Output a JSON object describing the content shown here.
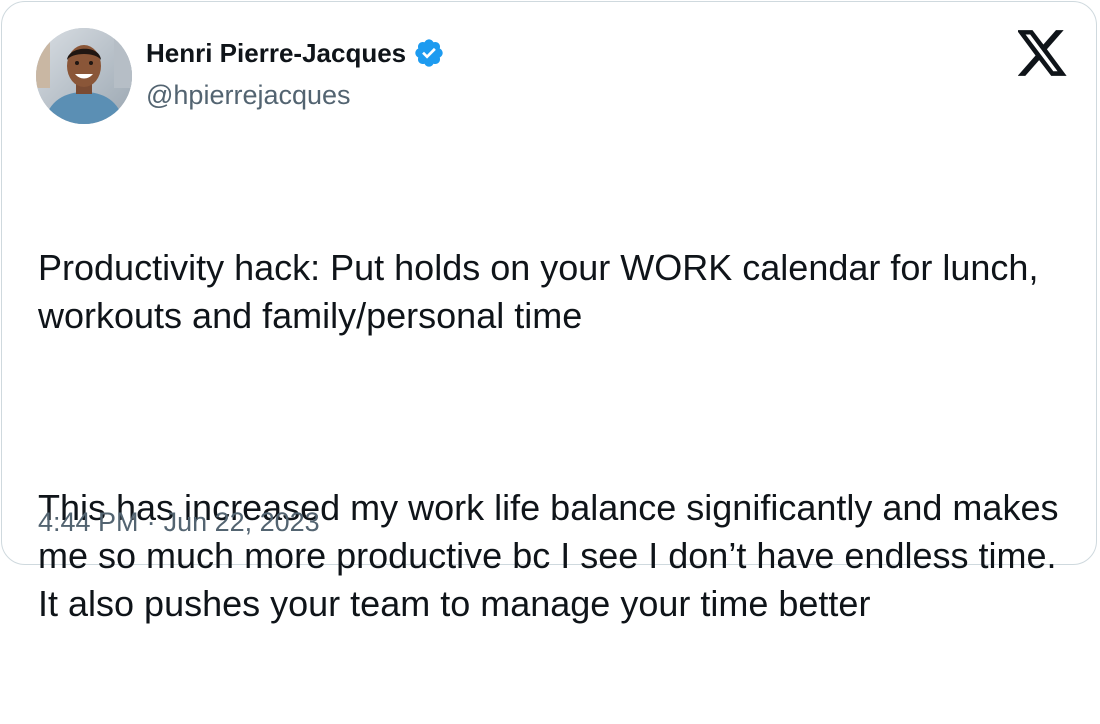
{
  "author": {
    "display_name": "Henri Pierre-Jacques",
    "handle": "@hpierrejacques",
    "verified": true,
    "avatar_icon": "profile-photo"
  },
  "platform": {
    "logo_icon": "x-logo"
  },
  "tweet": {
    "paragraphs": [
      "Productivity hack: Put holds on your WORK calendar for lunch, workouts and family/personal time",
      "This has increased my work life balance significantly and makes me so much more productive bc I see I don’t have endless time. It also pushes your team to manage your time better"
    ]
  },
  "meta": {
    "time": "4:44 PM",
    "separator": "·",
    "date": "Jun 22, 2023"
  },
  "colors": {
    "text_primary": "#0f1419",
    "text_secondary": "#536471",
    "verified_badge": "#1d9bf0",
    "border": "#cfd9de"
  }
}
